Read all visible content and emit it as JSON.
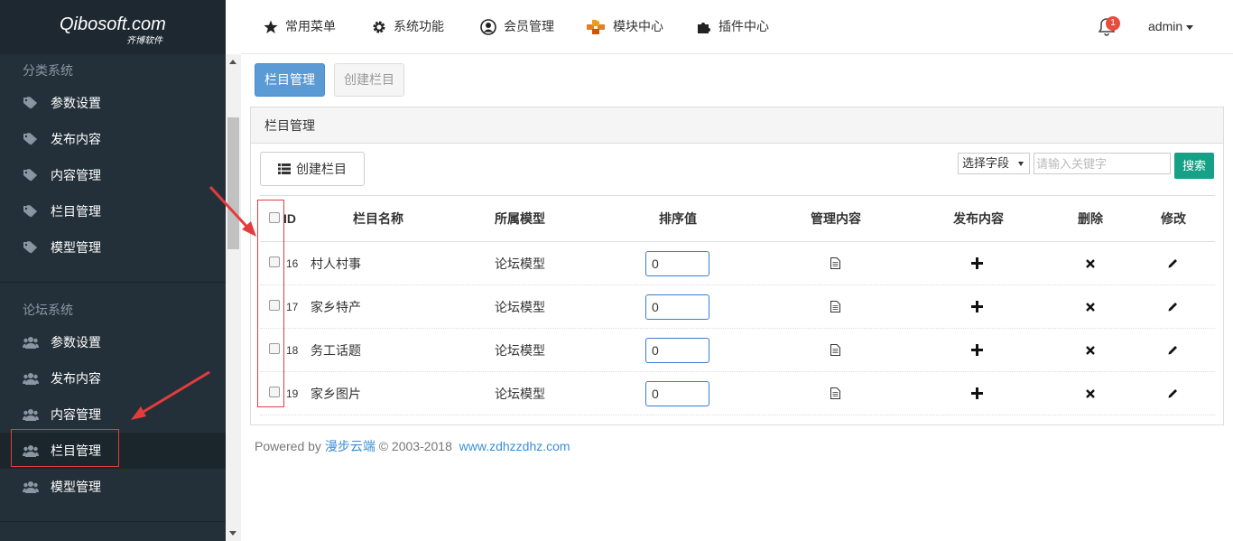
{
  "logo": {
    "text": "Qibosoft.com",
    "sub": "齐博软件"
  },
  "sidebar": {
    "sections": [
      {
        "title": "分类系统",
        "items": [
          {
            "label": "参数设置",
            "icon": "tags-icon"
          },
          {
            "label": "发布内容",
            "icon": "tags-icon"
          },
          {
            "label": "内容管理",
            "icon": "tags-icon"
          },
          {
            "label": "栏目管理",
            "icon": "tags-icon"
          },
          {
            "label": "模型管理",
            "icon": "tags-icon"
          }
        ]
      },
      {
        "title": "论坛系统",
        "items": [
          {
            "label": "参数设置",
            "icon": "users-icon"
          },
          {
            "label": "发布内容",
            "icon": "users-icon"
          },
          {
            "label": "内容管理",
            "icon": "users-icon"
          },
          {
            "label": "栏目管理",
            "icon": "users-icon",
            "active": true
          },
          {
            "label": "模型管理",
            "icon": "users-icon"
          }
        ]
      }
    ]
  },
  "topnav": {
    "items": [
      {
        "label": "常用菜单",
        "icon": "star-icon"
      },
      {
        "label": "系统功能",
        "icon": "gear-icon"
      },
      {
        "label": "会员管理",
        "icon": "user-circle-icon"
      },
      {
        "label": "模块中心",
        "icon": "cubes-icon"
      },
      {
        "label": "插件中心",
        "icon": "puzzle-icon"
      }
    ],
    "notification_count": "1",
    "user": "admin"
  },
  "tabs": {
    "active": "栏目管理",
    "other": "创建栏目"
  },
  "panel": {
    "title": "栏目管理",
    "create_button": "创建栏目",
    "select_label": "选择字段",
    "search_placeholder": "请输入关键字",
    "search_button": "搜索"
  },
  "table": {
    "headers": [
      "ID",
      "栏目名称",
      "所属模型",
      "排序值",
      "管理内容",
      "发布内容",
      "删除",
      "修改"
    ],
    "rows": [
      {
        "id": "16",
        "name": "村人村事",
        "model": "论坛模型",
        "sort": "0"
      },
      {
        "id": "17",
        "name": "家乡特产",
        "model": "论坛模型",
        "sort": "0"
      },
      {
        "id": "18",
        "name": "务工话题",
        "model": "论坛模型",
        "sort": "0"
      },
      {
        "id": "19",
        "name": "家乡图片",
        "model": "论坛模型",
        "sort": "0"
      }
    ]
  },
  "footer": {
    "powered": "Powered by",
    "brand": "漫步云端",
    "copyright": "© 2003-2018",
    "site": "www.zdhzzdhz.com"
  },
  "colors": {
    "sidebar_bg": "#243039",
    "primary": "#5b9bd5",
    "search": "#16a085",
    "annotation": "#e43c3c"
  }
}
